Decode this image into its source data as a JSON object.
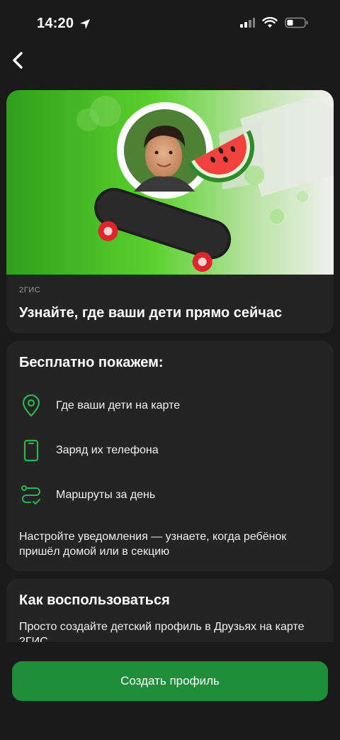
{
  "status_bar": {
    "time": "14:20",
    "icons": [
      "location-arrow-icon",
      "signal-icon",
      "wifi-icon",
      "battery-icon"
    ]
  },
  "nav": {
    "back_icon": "chevron-left-icon"
  },
  "hero": {
    "source": "2ГИС",
    "title": "Узнайте, где ваши дети прямо сейчас",
    "image": "boy-skateboard-watermelon-illustration"
  },
  "features": {
    "heading": "Бесплатно покажем:",
    "items": [
      {
        "icon": "map-pin-icon",
        "label": "Где ваши дети на карте"
      },
      {
        "icon": "phone-icon",
        "label": "Заряд их телефона"
      },
      {
        "icon": "route-icon",
        "label": "Маршруты за день"
      }
    ],
    "note": "Настройте уведомления — узнаете, когда ребёнок пришёл домой или в секцию"
  },
  "howto": {
    "heading": "Как воспользоваться",
    "text": "Просто создайте детский профиль в Друзьях на карте 2ГИС"
  },
  "cta": {
    "label": "Создать профиль"
  },
  "colors": {
    "accent": "#1f8e3b",
    "icon_green": "#2fb34f",
    "background": "#1a1a1a",
    "card": "#242424"
  }
}
